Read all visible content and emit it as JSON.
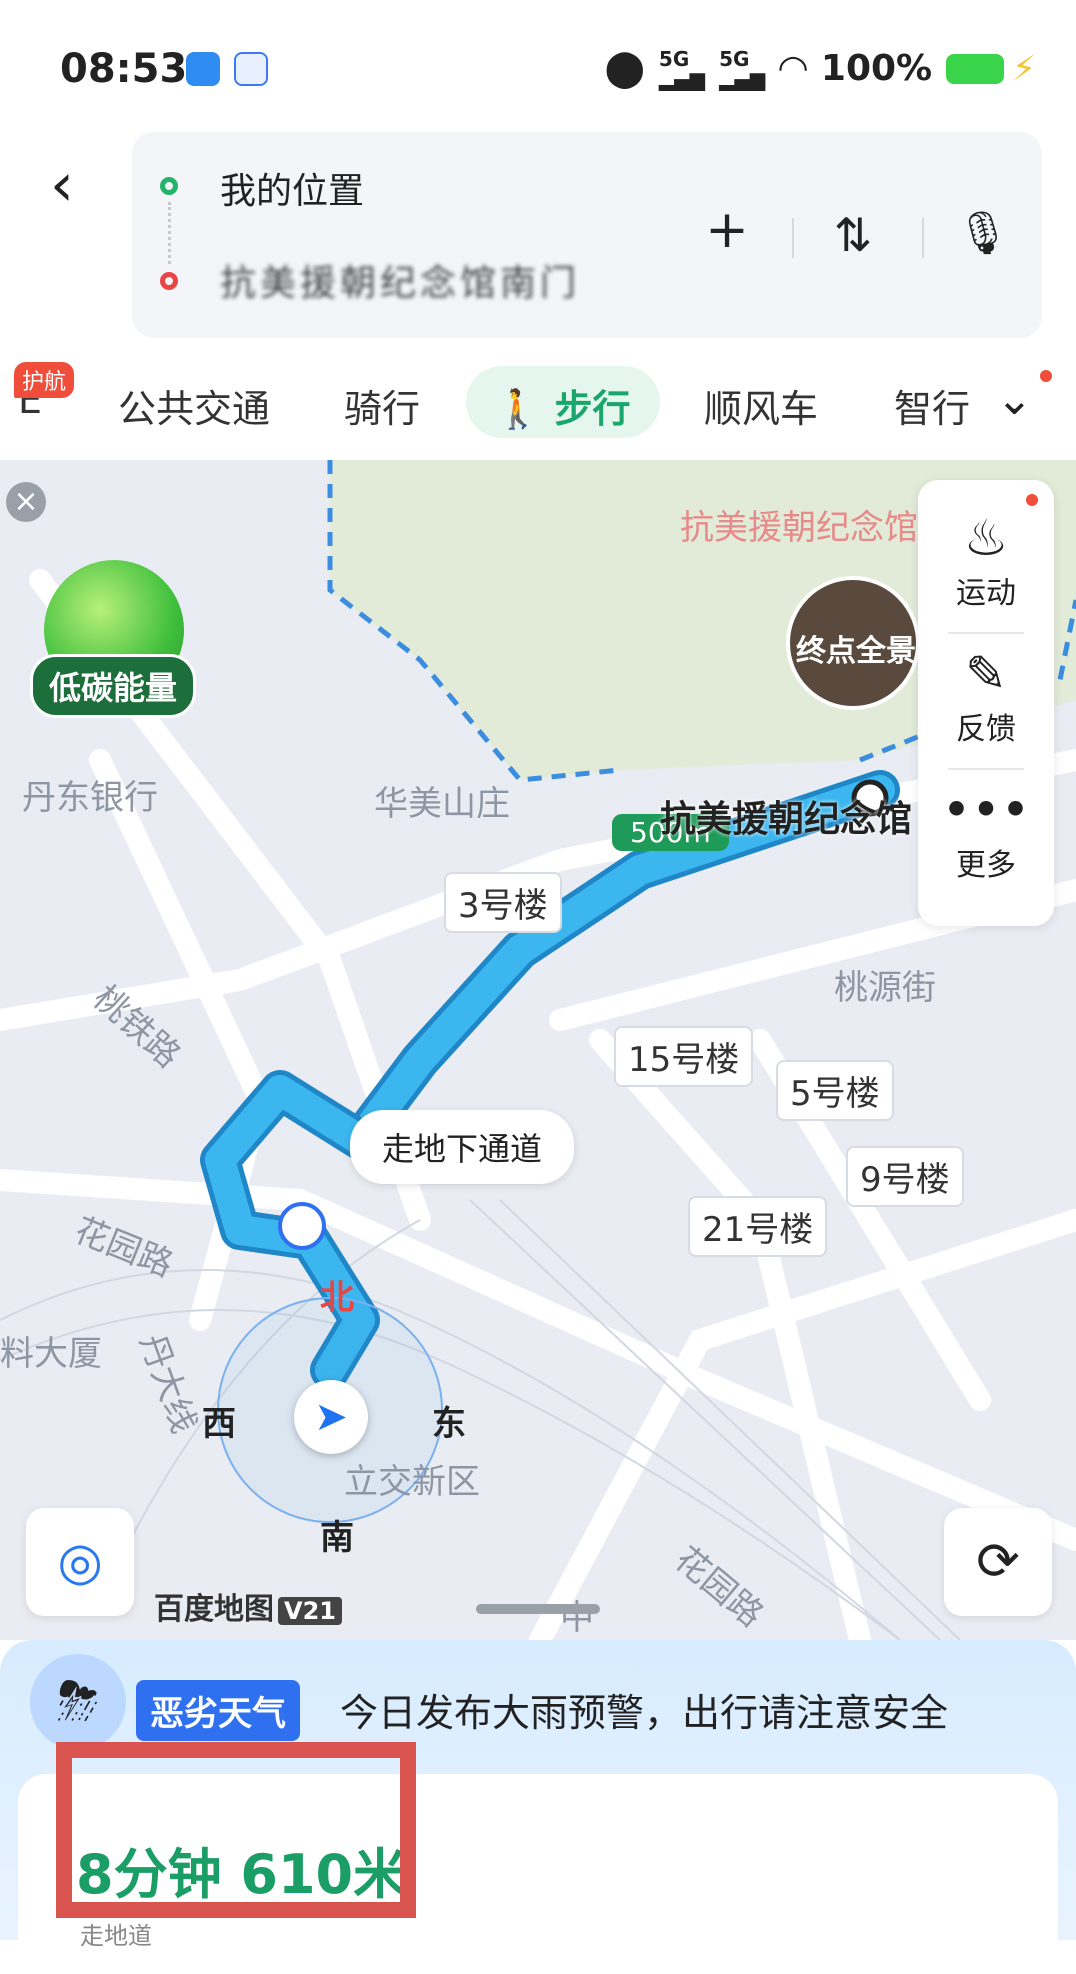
{
  "status_bar": {
    "time": "08:53",
    "network": "5G",
    "network2": "5G",
    "battery": "100%",
    "icons": [
      "location-icon",
      "signal-icon",
      "wifi-icon",
      "battery-icon",
      "charging-icon"
    ]
  },
  "search": {
    "from": "我的位置",
    "to": "抗美援朝纪念馆南门"
  },
  "tabs": {
    "partial_left": "E",
    "badge": "护航",
    "transit": "公共交通",
    "ride": "骑行",
    "walk": "步行",
    "carpool": "顺风车",
    "smart": "智行"
  },
  "map": {
    "carbon": "低碳能量",
    "poi_top": "抗美援朝纪念馆",
    "destination": "抗美援朝纪念馆",
    "pano": "终点全景",
    "scale": "500m",
    "tip": "走地下通道",
    "labels": {
      "bank": "丹东银行",
      "huamei": "华美山庄",
      "taoyuan": "桃源街",
      "taotie": "桃铁路",
      "huayuan": "花园路",
      "liaodasha": "料大厦",
      "dandaxian": "丹大线",
      "lijiao": "立交新区",
      "huayuan2": "花园路",
      "zhong": "中"
    },
    "buildings": [
      "3号楼",
      "15号楼",
      "5号楼",
      "9号楼",
      "21号楼"
    ],
    "compass": {
      "n": "北",
      "e": "东",
      "s": "南",
      "w": "西"
    },
    "side_panel": {
      "sport": "运动",
      "feedback": "反馈",
      "more": "更多"
    },
    "brand": "百度地图",
    "brand_version": "V21"
  },
  "sheet": {
    "weather_badge": "恶劣天气",
    "weather_text": "今日发布大雨预警，出行请注意安全",
    "result": "8分钟 610米",
    "result_sub": "走地道"
  },
  "colors": {
    "route": "#2fa8e6",
    "accent_green": "#1a9e66",
    "alert": "#d9534f"
  }
}
